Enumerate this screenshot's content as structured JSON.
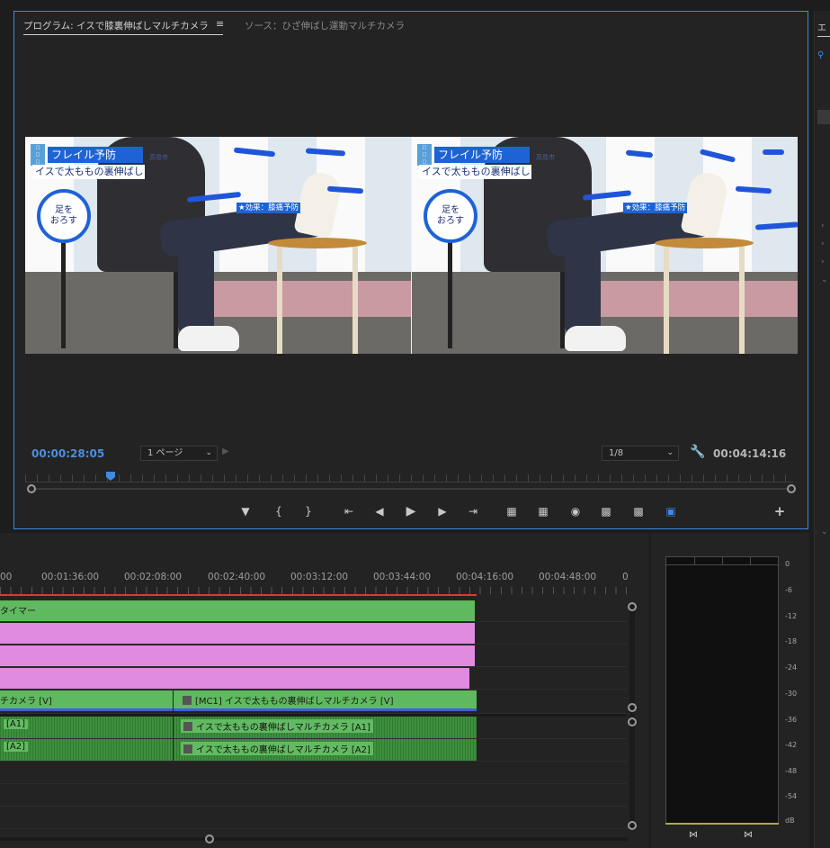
{
  "monitor": {
    "tab_program": "プログラム: イスで膝裏伸ばしマルチカメラ",
    "tab_menu_icon": "≡",
    "tab_source": "ソース：ひざ伸ばし運動マルチカメラ",
    "timecode_current": "00:00:28:05",
    "timecode_duration": "00:04:14:16",
    "zoom_value": "1 ページ",
    "resolution_value": "1/8",
    "video_overlay": {
      "title": "フレイル予防",
      "subtitle": "イスで太ももの裏伸ばし",
      "circle_text": "足を\nおろす",
      "effect_text": "★効果：膝痛予防",
      "city_text": "高島市"
    }
  },
  "timeline": {
    "time_labels": [
      "00",
      "00:01:36:00",
      "00:02:08:00",
      "00:02:40:00",
      "00:03:12:00",
      "00:03:44:00",
      "00:04:16:00",
      "00:04:48:00",
      "0"
    ],
    "tracks": {
      "v4_label": "タイマー",
      "v1_left_label": "チカメラ [V]",
      "v1_right_label": "[MC1] イスで太ももの裏伸ばしマルチカメラ [V]",
      "a1_left_label": "[A1]",
      "a1_right_label": "イスで太ももの裏伸ばしマルチカメラ [A1]",
      "a2_left_label": "[A2]",
      "a2_right_label": "イスで太ももの裏伸ばしマルチカメラ [A2]"
    }
  },
  "meter": {
    "db_labels": [
      "0",
      "-6",
      "-12",
      "-18",
      "-24",
      "-30",
      "-36",
      "-42",
      "-48",
      "-54",
      "dB"
    ]
  },
  "right_panel": {
    "tab_initial": "エ"
  },
  "colors": {
    "accent": "#3f8ae0",
    "clip_green": "#5fb95e",
    "clip_pink": "#e08ae0",
    "playhead_red": "#d83a2e"
  },
  "icons": [
    "menu-icon",
    "wrench-icon",
    "marker-icon",
    "mark-in-icon",
    "mark-out-icon",
    "go-to-in-icon",
    "step-back-icon",
    "play-icon",
    "step-forward-icon",
    "go-to-out-icon",
    "lift-icon",
    "extract-icon",
    "camera-icon",
    "insert-icon",
    "overwrite-icon",
    "multicam-icon",
    "add-icon"
  ]
}
